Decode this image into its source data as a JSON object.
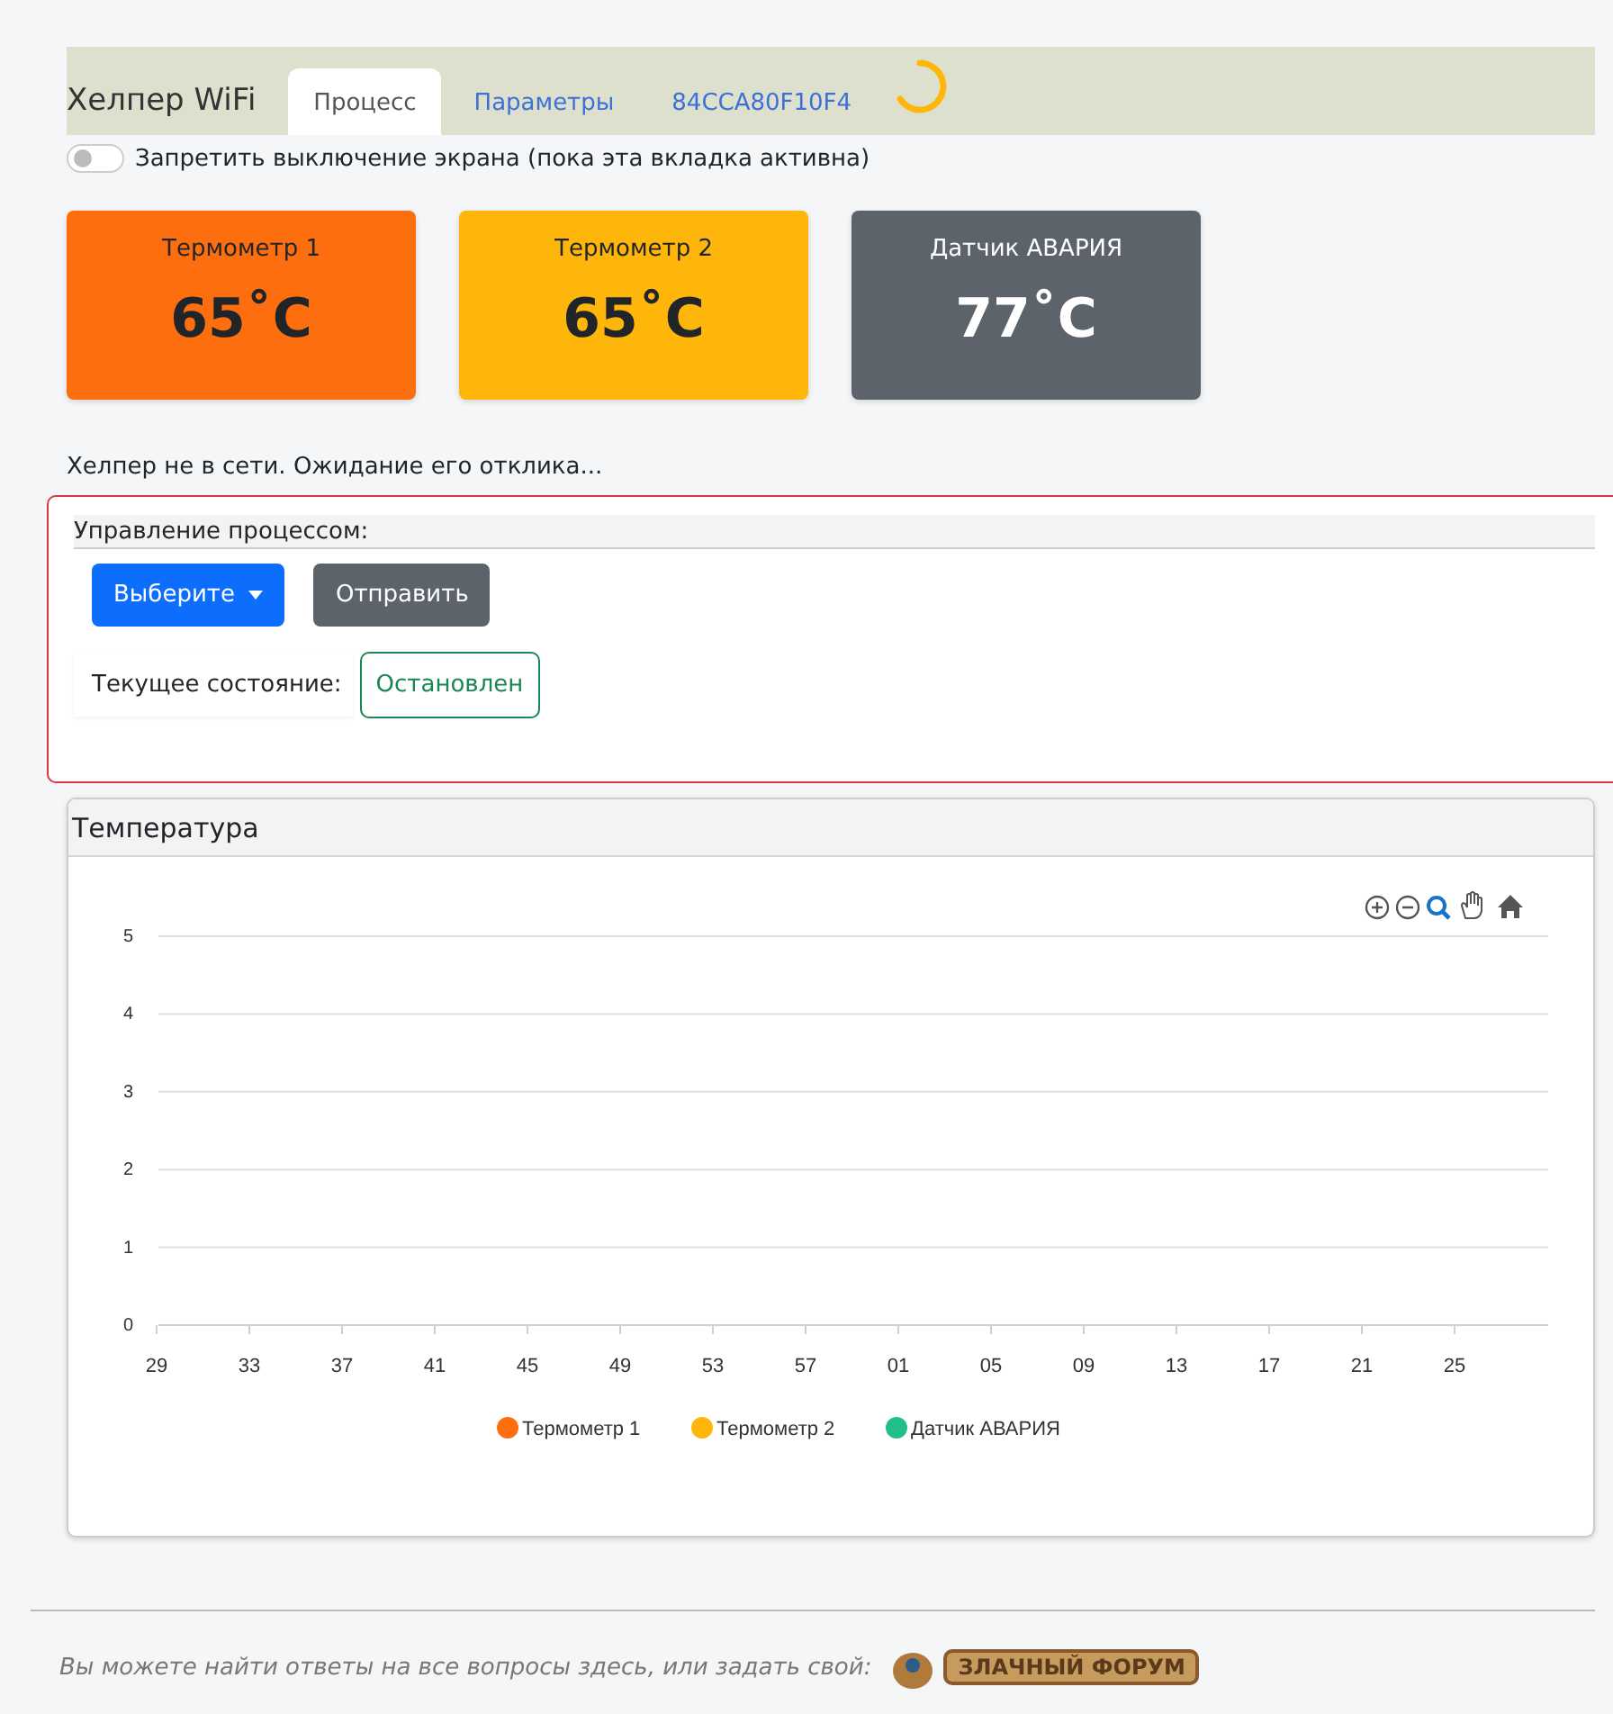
{
  "navbar": {
    "brand": "Хелпер WiFi",
    "tabs": [
      {
        "label": "Процесс",
        "selected": true
      },
      {
        "label": "Параметры",
        "selected": false
      },
      {
        "label": "84CCA80F10F4",
        "selected": false
      }
    ],
    "loading": true
  },
  "screen_lock": {
    "label": "Запретить выключение экрана (пока эта вкладка активна)",
    "on": false
  },
  "sensors": [
    {
      "name": "Термометр 1",
      "value": "65˚C",
      "color": "#fd6e0f"
    },
    {
      "name": "Термометр 2",
      "value": "65˚C",
      "color": "#ffb60a"
    },
    {
      "name": "Датчик АВАРИЯ",
      "value": "77˚C",
      "color": "#5c636a"
    }
  ],
  "status_message": "Хелпер не в сети. Ожидание его отклика...",
  "control": {
    "title": "Управление процессом:",
    "dropdown": "Выберите",
    "send_button": "Отправить",
    "state_label": "Текущее состояние:",
    "state": "Остановлен"
  },
  "temperature_panel": {
    "title": "Температура",
    "chart_data": {
      "type": "line",
      "grid": true,
      "categories": [
        "29",
        "33",
        "37",
        "41",
        "45",
        "49",
        "53",
        "57",
        "01",
        "05",
        "09",
        "13",
        "17",
        "21",
        "25"
      ],
      "ylim": [
        0,
        5
      ],
      "yticks": [
        0,
        1,
        2,
        3,
        4,
        5
      ],
      "series": [
        {
          "name": "Термометр 1",
          "color": "#fd6e0f",
          "values": [
            null,
            null,
            null,
            null,
            null,
            null,
            null,
            null,
            null,
            null,
            null,
            null,
            null,
            null,
            null
          ]
        },
        {
          "name": "Термометр 2",
          "color": "#ffb60a",
          "values": [
            null,
            null,
            null,
            null,
            null,
            null,
            null,
            null,
            null,
            null,
            null,
            null,
            null,
            null,
            null
          ]
        },
        {
          "name": "Датчик АВАРИЯ",
          "color": "#20c088",
          "values": [
            null,
            null,
            null,
            null,
            null,
            null,
            null,
            null,
            null,
            null,
            null,
            null,
            null,
            null,
            null
          ]
        }
      ]
    }
  },
  "footer": {
    "text": "Вы можете найти ответы на все вопросы здесь, или задать свой:",
    "logo_text": "ЗЛАЧНЫЙ ФОРУМ"
  }
}
